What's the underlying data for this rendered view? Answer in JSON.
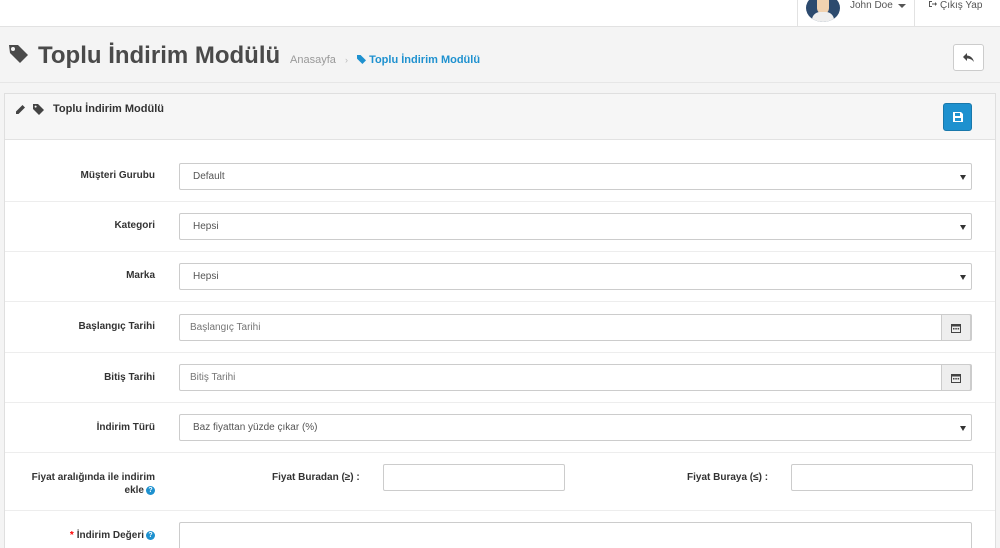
{
  "topbar": {
    "user_name": "John Doe",
    "logout_label": "Çıkış Yap"
  },
  "header": {
    "title": "Toplu İndirim Modülü",
    "breadcrumb": [
      {
        "label": "Anasayfa"
      },
      {
        "label": "Toplu İndirim Modülü"
      }
    ]
  },
  "panel": {
    "title": "Toplu İndirim Modülü"
  },
  "form": {
    "customer_group": {
      "label": "Müşteri Gurubu",
      "value": "Default"
    },
    "category": {
      "label": "Kategori",
      "value": "Hepsi"
    },
    "brand": {
      "label": "Marka",
      "value": "Hepsi"
    },
    "start_date": {
      "label": "Başlangıç Tarihi",
      "placeholder": "Başlangıç Tarihi",
      "value": ""
    },
    "end_date": {
      "label": "Bitiş Tarihi",
      "placeholder": "Bitiş Tarihi",
      "value": ""
    },
    "discount_type": {
      "label": "İndirim Türü",
      "value": "Baz fiyattan yüzde çıkar (%)"
    },
    "price_range": {
      "label_line1": "Fiyat aralığında ile indirim",
      "label_line2": "ekle",
      "from_label": "Fiyat Buradan (≥) :",
      "to_label": "Fiyat Buraya (≤) :"
    },
    "discount_value": {
      "label": "İndirim Değeri",
      "required_mark": "*"
    }
  },
  "icons": {
    "user_caret": "caret-down-icon",
    "logout": "sign-out-icon",
    "title": "tag-icon",
    "back": "reply-icon",
    "panel_edit": "pencil-icon",
    "panel_tag": "tag-icon",
    "save": "save-icon",
    "calendar": "calendar-icon",
    "help": "question-circle-icon"
  },
  "colors": {
    "accent": "#1e91cf",
    "required": "#ff0000",
    "title_text": "#4a4a4a"
  }
}
